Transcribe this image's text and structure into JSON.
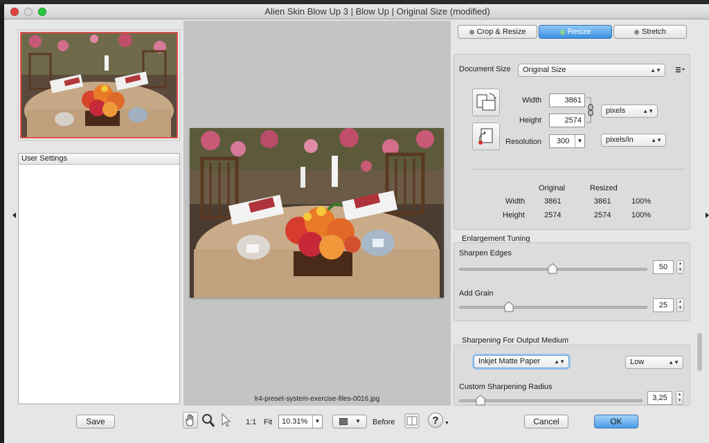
{
  "window": {
    "title": "Alien Skin Blow Up 3 | Blow Up | Original Size (modified)"
  },
  "left": {
    "user_settings_label": "User Settings"
  },
  "preview": {
    "filename": "lr4-preset-system-exercise-files-0016.jpg"
  },
  "tabs": [
    {
      "label": "Crop & Resize",
      "icon": "crop-dot-icon",
      "active": false
    },
    {
      "label": "Resize",
      "icon": "resize-dot-icon",
      "active": true
    },
    {
      "label": "Stretch",
      "icon": "stretch-dot-icon",
      "active": false
    }
  ],
  "document_size": {
    "label": "Document Size",
    "preset": "Original Size",
    "width_label": "Width",
    "width_value": "3861",
    "height_label": "Height",
    "height_value": "2574",
    "unit": "pixels",
    "resolution_label": "Resolution",
    "resolution_value": "300",
    "resolution_unit": "pixels/in"
  },
  "comparison": {
    "original_label": "Original",
    "resized_label": "Resized",
    "width_label": "Width",
    "width_original": "3861",
    "width_resized": "3861",
    "width_percent": "100%",
    "height_label": "Height",
    "height_original": "2574",
    "height_resized": "2574",
    "height_percent": "100%"
  },
  "enlargement": {
    "title": "Enlargement Tuning",
    "sharpen_label": "Sharpen Edges",
    "sharpen_value": "50",
    "sharpen_fraction": 0.5,
    "grain_label": "Add Grain",
    "grain_value": "25",
    "grain_fraction": 0.25
  },
  "output": {
    "title": "Sharpening For Output Medium",
    "medium": "Inkjet Matte Paper",
    "amount": "Low",
    "radius_label": "Custom Sharpening Radius",
    "radius_value": "3,25",
    "radius_fraction": 0.1
  },
  "bottom": {
    "save_label": "Save",
    "one_to_one_label": "1:1",
    "fit_label": "Fit",
    "zoom_value": "10.31%",
    "before_label": "Before",
    "help_label": "?",
    "cancel_label": "Cancel",
    "ok_label": "OK"
  },
  "colors": {
    "accent": "#3a8fe0",
    "close": "#e0443e",
    "zoom": "#27c93f",
    "selection": "#e0514d"
  }
}
